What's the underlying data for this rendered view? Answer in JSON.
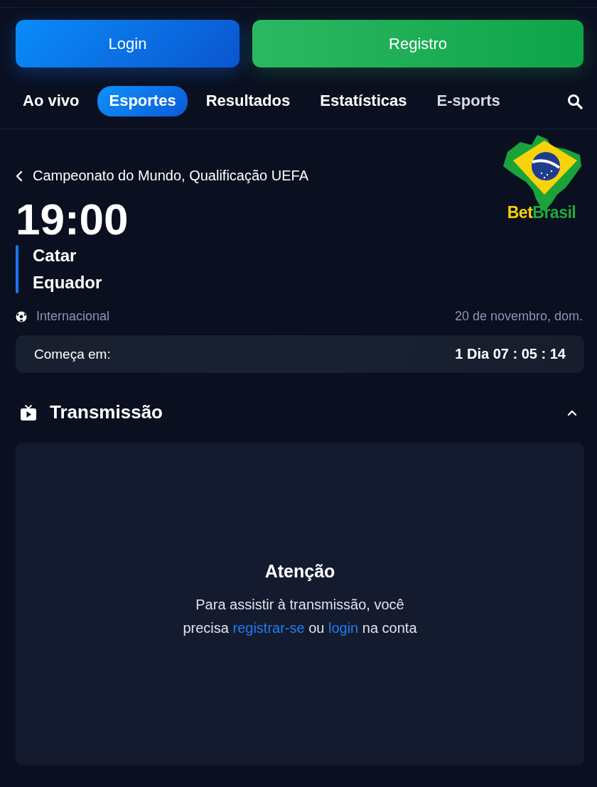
{
  "auth_buttons": [
    {
      "label": "Login",
      "kind": "login"
    },
    {
      "label": "Registro",
      "kind": "register"
    }
  ],
  "tabs": [
    {
      "label": "Ao vivo",
      "selected": false
    },
    {
      "label": "Esportes",
      "selected": true
    },
    {
      "label": "Resultados",
      "selected": false
    },
    {
      "label": "Estatísticas",
      "selected": false
    },
    {
      "label": "E-sports",
      "selected": false
    }
  ],
  "breadcrumb": "Campeonato do Mundo, Qualificação UEFA",
  "logo": {
    "word_1": "Bet",
    "word_2": "Brasil"
  },
  "match": {
    "time": "19:00",
    "teams": [
      "Catar",
      "Equador"
    ],
    "sport": "Internacional",
    "date": "20 de novembro, dom."
  },
  "countdown": {
    "label": "Começa em:",
    "value": "1 Dia 07 : 05 : 14"
  },
  "broadcast": {
    "title": "Transmissão",
    "expanded": true,
    "heading": "Atenção",
    "message": [
      {
        "text": "Para assistir à transmissão, você precisa "
      },
      {
        "text": "registrar-se",
        "kind": "link"
      },
      {
        "text": " ou "
      },
      {
        "text": "login",
        "kind": "link"
      },
      {
        "text": " na conta"
      }
    ]
  }
}
